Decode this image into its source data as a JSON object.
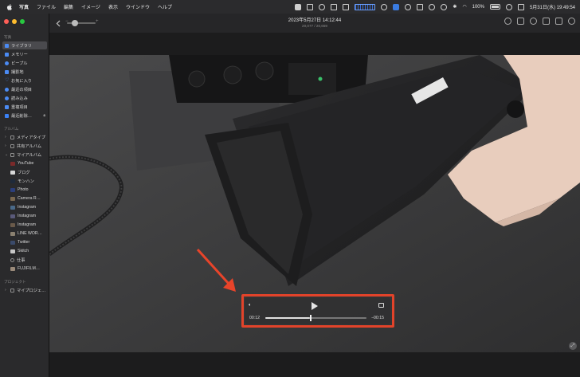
{
  "menubar": {
    "app_name": "写真",
    "items": [
      "ファイル",
      "編集",
      "イメージ",
      "表示",
      "ウインドウ",
      "ヘルプ"
    ],
    "battery_percent": "100%",
    "datetime": "5月31日(水)  19:49:54"
  },
  "sidebar": {
    "section_library": "写真",
    "library_items": [
      {
        "label": "ライブラリ",
        "icon": "library-icon",
        "selected": true
      },
      {
        "label": "メモリー",
        "icon": "memories-icon"
      },
      {
        "label": "ピープル",
        "icon": "people-icon"
      },
      {
        "label": "撮影地",
        "icon": "places-icon"
      },
      {
        "label": "お気に入り",
        "icon": "heart-icon"
      },
      {
        "label": "最近の項目",
        "icon": "recent-icon"
      },
      {
        "label": "読み込み",
        "icon": "import-icon"
      },
      {
        "label": "重複項目",
        "icon": "duplicates-icon"
      },
      {
        "label": "最近削除…",
        "icon": "trash-icon",
        "locked": true
      }
    ],
    "section_albums": "アルバム",
    "album_groups": [
      {
        "label": "メディアタイプ"
      },
      {
        "label": "共有アルバム"
      },
      {
        "label": "マイアルバム"
      }
    ],
    "my_albums": [
      "YouTube",
      "ブログ",
      "モンハン",
      "Photo",
      "Camera R…",
      "Instagram",
      "Instagram",
      "Instagram",
      "LINE WOR…",
      "Twitter",
      "Skitch",
      "仕事",
      "FUJIFILM…"
    ],
    "section_projects": "プロジェクト",
    "project_items": [
      "マイプロジェ…"
    ]
  },
  "toolbar": {
    "title": "2023年5月27日  14:12:44",
    "subtitle": "20,077 / 20,659"
  },
  "video_controls": {
    "elapsed": "00:12",
    "remaining": "−00:15",
    "progress": 0.44
  },
  "colors": {
    "highlight": "#e2432a",
    "accent": "#4b8bf4",
    "arrow": "#e8442a"
  }
}
